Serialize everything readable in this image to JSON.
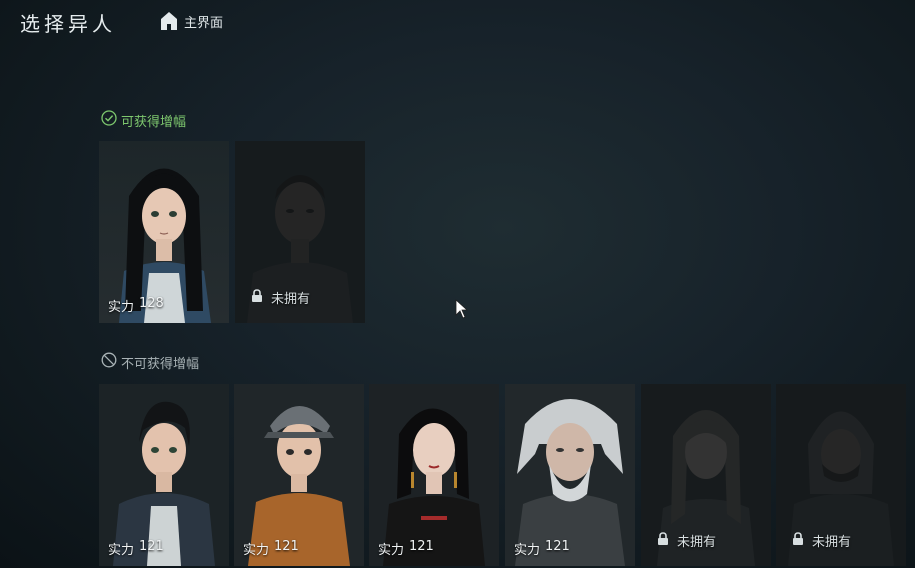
{
  "header": {
    "title": "选择异人",
    "home_icon": "home-icon",
    "home_label": "主界面"
  },
  "sections": {
    "available": {
      "icon": "check-circle-icon",
      "label": "可获得增幅",
      "color": "#7ec86e"
    },
    "unavailable": {
      "icon": "prohibited-icon",
      "label": "不可获得增幅",
      "color": "#a9b3b6"
    }
  },
  "available_cards": [
    {
      "power_label": "实力",
      "power_value": "128",
      "owned": true,
      "selected": true
    },
    {
      "lock_label": "未拥有",
      "owned": false,
      "lock_icon": "lock-icon"
    }
  ],
  "unavailable_cards": [
    {
      "power_label": "实力",
      "power_value": "121",
      "owned": true
    },
    {
      "power_label": "实力",
      "power_value": "121",
      "owned": true
    },
    {
      "power_label": "实力",
      "power_value": "121",
      "owned": true
    },
    {
      "power_label": "实力",
      "power_value": "121",
      "owned": true
    },
    {
      "lock_label": "未拥有",
      "owned": false,
      "lock_icon": "lock-icon"
    },
    {
      "lock_label": "未拥有",
      "owned": false,
      "lock_icon": "lock-icon"
    }
  ]
}
